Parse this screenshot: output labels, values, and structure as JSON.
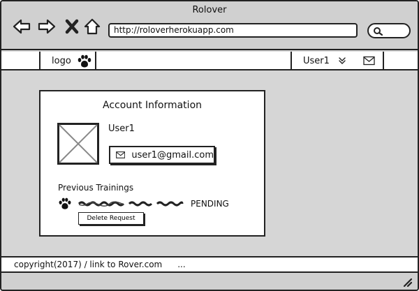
{
  "window": {
    "title": "Rolover"
  },
  "browser": {
    "url": "http://roloverherokuapp.com",
    "icons": {
      "back": "arrow-left-icon",
      "forward": "arrow-right-icon",
      "stop": "close-icon",
      "home": "home-icon",
      "search": "search-icon"
    }
  },
  "appbar": {
    "logo_label": "logo",
    "logo_icon": "paw-icon",
    "user_label": "User1",
    "chevron_icon": "chevron-double-down-icon",
    "mail_icon": "mail-icon"
  },
  "account": {
    "title": "Account Information",
    "username": "User1",
    "email": "user1@gmail.com",
    "avatar_icon": "image-placeholder-icon",
    "previous_trainings_label": "Previous Trainings",
    "training": {
      "status": "PENDING",
      "delete_label": "Delete Request"
    }
  },
  "footer": {
    "copyright": "copyright(2017) / link to Rover.com",
    "more": "..."
  },
  "colors": {
    "frame": "#222222",
    "chrome": "#d0d0d0",
    "canvas": "#d6d6d6",
    "surface": "#ffffff"
  }
}
